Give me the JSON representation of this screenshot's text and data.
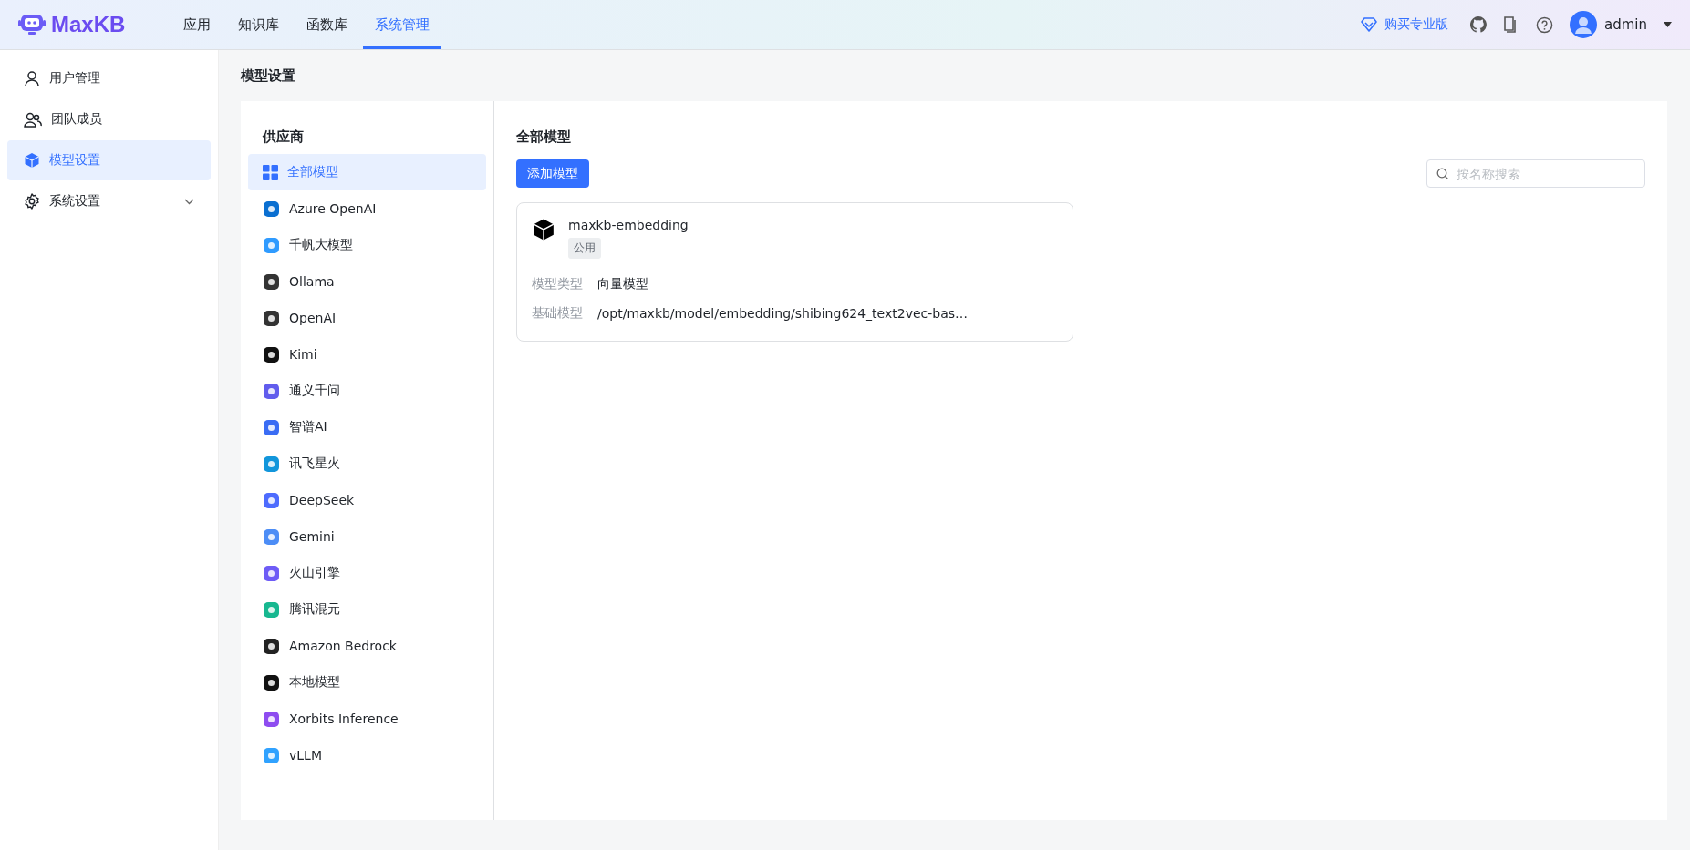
{
  "header": {
    "logo": "MaxKB",
    "nav": [
      {
        "label": "应用",
        "selected": false
      },
      {
        "label": "知识库",
        "selected": false
      },
      {
        "label": "函数库",
        "selected": false
      },
      {
        "label": "系统管理",
        "selected": true
      }
    ],
    "upgrade": "购买专业版",
    "user": "admin"
  },
  "sidebar": {
    "items": [
      {
        "label": "用户管理",
        "selected": false
      },
      {
        "label": "团队成员",
        "selected": false
      },
      {
        "label": "模型设置",
        "selected": true
      },
      {
        "label": "系统设置",
        "selected": false,
        "expanded": false
      }
    ]
  },
  "page_title": "模型设置",
  "providers": {
    "title": "供应商",
    "items": [
      {
        "label": "全部模型",
        "selected": true
      },
      {
        "label": "Azure OpenAI",
        "selected": false
      },
      {
        "label": "千帆大模型",
        "selected": false
      },
      {
        "label": "Ollama",
        "selected": false
      },
      {
        "label": "OpenAI",
        "selected": false
      },
      {
        "label": "Kimi",
        "selected": false
      },
      {
        "label": "通义千问",
        "selected": false
      },
      {
        "label": "智谱AI",
        "selected": false
      },
      {
        "label": "讯飞星火",
        "selected": false
      },
      {
        "label": "DeepSeek",
        "selected": false
      },
      {
        "label": "Gemini",
        "selected": false
      },
      {
        "label": "火山引擎",
        "selected": false
      },
      {
        "label": "腾讯混元",
        "selected": false
      },
      {
        "label": "Amazon Bedrock",
        "selected": false
      },
      {
        "label": "本地模型",
        "selected": false
      },
      {
        "label": "Xorbits Inference",
        "selected": false
      },
      {
        "label": "vLLM",
        "selected": false
      }
    ]
  },
  "models": {
    "title": "全部模型",
    "add_button": "添加模型",
    "search": {
      "placeholder": "按名称搜索"
    },
    "cards": [
      {
        "name": "maxkb-embedding",
        "tag": "公用",
        "fields": [
          {
            "label": "模型类型",
            "value": "向量模型"
          },
          {
            "label": "基础模型",
            "value": "/opt/maxkb/model/embedding/shibing624_text2vec-bas…"
          }
        ]
      }
    ]
  }
}
